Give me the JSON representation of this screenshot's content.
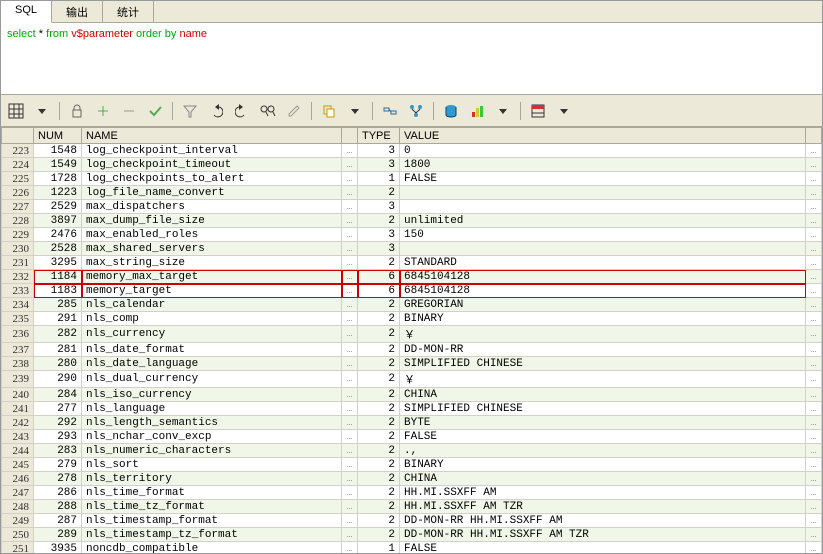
{
  "tabs": {
    "sql": "SQL",
    "output": "输出",
    "stats": "统计"
  },
  "sql_parts": {
    "select": "select",
    "star": " * ",
    "from": "from ",
    "table": "v$parameter",
    "order": " order by ",
    "col": "name"
  },
  "headers": {
    "num": "NUM",
    "name": "NAME",
    "type": "TYPE",
    "value": "VALUE"
  },
  "rows": [
    {
      "r": 223,
      "num": 1548,
      "name": "log_checkpoint_interval",
      "type": 3,
      "value": "0"
    },
    {
      "r": 224,
      "num": 1549,
      "name": "log_checkpoint_timeout",
      "type": 3,
      "value": "1800"
    },
    {
      "r": 225,
      "num": 1728,
      "name": "log_checkpoints_to_alert",
      "type": 1,
      "value": "FALSE"
    },
    {
      "r": 226,
      "num": 1223,
      "name": "log_file_name_convert",
      "type": 2,
      "value": ""
    },
    {
      "r": 227,
      "num": 2529,
      "name": "max_dispatchers",
      "type": 3,
      "value": ""
    },
    {
      "r": 228,
      "num": 3897,
      "name": "max_dump_file_size",
      "type": 2,
      "value": "unlimited"
    },
    {
      "r": 229,
      "num": 2476,
      "name": "max_enabled_roles",
      "type": 3,
      "value": "150"
    },
    {
      "r": 230,
      "num": 2528,
      "name": "max_shared_servers",
      "type": 3,
      "value": ""
    },
    {
      "r": 231,
      "num": 3295,
      "name": "max_string_size",
      "type": 2,
      "value": "STANDARD"
    },
    {
      "r": 232,
      "num": 1184,
      "name": "memory_max_target",
      "type": 6,
      "value": "6845104128",
      "hl": true
    },
    {
      "r": 233,
      "num": 1183,
      "name": "memory_target",
      "type": 6,
      "value": "6845104128",
      "hl": true
    },
    {
      "r": 234,
      "num": 285,
      "name": "nls_calendar",
      "type": 2,
      "value": "GREGORIAN"
    },
    {
      "r": 235,
      "num": 291,
      "name": "nls_comp",
      "type": 2,
      "value": "BINARY"
    },
    {
      "r": 236,
      "num": 282,
      "name": "nls_currency",
      "type": 2,
      "value": "￥"
    },
    {
      "r": 237,
      "num": 281,
      "name": "nls_date_format",
      "type": 2,
      "value": "DD-MON-RR"
    },
    {
      "r": 238,
      "num": 280,
      "name": "nls_date_language",
      "type": 2,
      "value": "SIMPLIFIED CHINESE"
    },
    {
      "r": 239,
      "num": 290,
      "name": "nls_dual_currency",
      "type": 2,
      "value": "￥"
    },
    {
      "r": 240,
      "num": 284,
      "name": "nls_iso_currency",
      "type": 2,
      "value": "CHINA"
    },
    {
      "r": 241,
      "num": 277,
      "name": "nls_language",
      "type": 2,
      "value": "SIMPLIFIED CHINESE"
    },
    {
      "r": 242,
      "num": 292,
      "name": "nls_length_semantics",
      "type": 2,
      "value": "BYTE"
    },
    {
      "r": 243,
      "num": 293,
      "name": "nls_nchar_conv_excp",
      "type": 2,
      "value": "FALSE"
    },
    {
      "r": 244,
      "num": 283,
      "name": "nls_numeric_characters",
      "type": 2,
      "value": ".,"
    },
    {
      "r": 245,
      "num": 279,
      "name": "nls_sort",
      "type": 2,
      "value": "BINARY"
    },
    {
      "r": 246,
      "num": 278,
      "name": "nls_territory",
      "type": 2,
      "value": "CHINA"
    },
    {
      "r": 247,
      "num": 286,
      "name": "nls_time_format",
      "type": 2,
      "value": "HH.MI.SSXFF AM"
    },
    {
      "r": 248,
      "num": 288,
      "name": "nls_time_tz_format",
      "type": 2,
      "value": "HH.MI.SSXFF AM TZR"
    },
    {
      "r": 249,
      "num": 287,
      "name": "nls_timestamp_format",
      "type": 2,
      "value": "DD-MON-RR HH.MI.SSXFF AM"
    },
    {
      "r": 250,
      "num": 289,
      "name": "nls_timestamp_tz_format",
      "type": 2,
      "value": "DD-MON-RR HH.MI.SSXFF AM TZR"
    },
    {
      "r": 251,
      "num": 3935,
      "name": "noncdb_compatible",
      "type": 1,
      "value": "FALSE"
    }
  ]
}
